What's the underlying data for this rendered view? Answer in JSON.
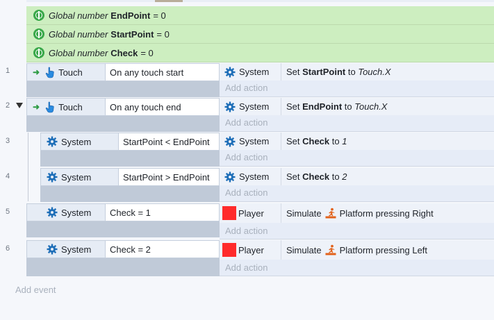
{
  "global_vars": [
    {
      "keyword": "Global number",
      "name": "EndPoint",
      "value": "= 0"
    },
    {
      "keyword": "Global number",
      "name": "StartPoint",
      "value": "= 0"
    },
    {
      "keyword": "Global number",
      "name": "Check",
      "value": "= 0"
    }
  ],
  "events": [
    {
      "line": "1",
      "cond_object": "Touch",
      "cond_text": "On any touch start",
      "act_object": "System",
      "act_prefix": "Set ",
      "act_bold": "StartPoint",
      "act_mid": " to ",
      "act_italic": "Touch.X",
      "add_action": "Add action"
    },
    {
      "line": "2",
      "cond_object": "Touch",
      "cond_text": "On any touch end",
      "act_object": "System",
      "act_prefix": "Set ",
      "act_bold": "EndPoint",
      "act_mid": " to ",
      "act_italic": "Touch.X",
      "add_action": "Add action"
    },
    {
      "line": "3",
      "cond_object": "System",
      "cond_text": "StartPoint < EndPoint",
      "act_object": "System",
      "act_prefix": "Set ",
      "act_bold": "Check",
      "act_mid": " to ",
      "act_italic": "1",
      "add_action": "Add action"
    },
    {
      "line": "4",
      "cond_object": "System",
      "cond_text": "StartPoint > EndPoint",
      "act_object": "System",
      "act_prefix": "Set ",
      "act_bold": "Check",
      "act_mid": " to ",
      "act_italic": "2",
      "add_action": "Add action"
    },
    {
      "line": "5",
      "cond_object": "System",
      "cond_text": "Check = 1",
      "act_object": "Player",
      "act_prefix": "Simulate",
      "act_suffix": "Platform pressing Right",
      "add_action": "Add action"
    },
    {
      "line": "6",
      "cond_object": "System",
      "cond_text": "Check = 2",
      "act_object": "Player",
      "act_prefix": "Simulate",
      "act_suffix": "Platform pressing Left",
      "add_action": "Add action"
    }
  ],
  "add_event": "Add event",
  "colors": {
    "global_bg": "#cdeec0",
    "player": "#ff2b2b",
    "trigger": "#2f9c45",
    "gear": "#1f6fb8"
  },
  "icons": {
    "global": "globe-icon",
    "touch": "touch-hand-icon",
    "system": "gear-icon",
    "trigger": "trigger-arrow-icon",
    "platform": "platform-behavior-icon"
  }
}
